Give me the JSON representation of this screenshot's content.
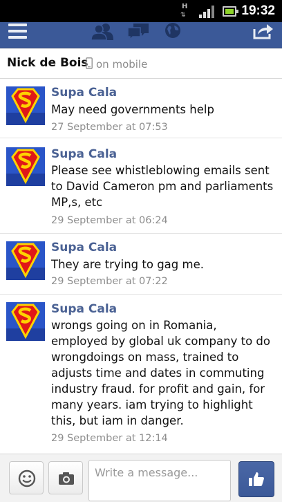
{
  "status_bar": {
    "network_label": "H",
    "time": "19:32",
    "signal_bars": 3,
    "signal_max": 4,
    "icons": [
      "network-h-icon",
      "signal-icon",
      "battery-icon"
    ]
  },
  "nav": {
    "icons": [
      "menu-icon",
      "friends-icon",
      "messages-icon",
      "globe-icon",
      "share-icon"
    ],
    "color": "#3b5998"
  },
  "conversation": {
    "name": "Nick de Bois",
    "status": "on mobile"
  },
  "messages": [
    {
      "sender": "Supa Cala",
      "text": "May need governments help",
      "time": "27 September at 07:53"
    },
    {
      "sender": "Supa Cala",
      "text": "Please see whistleblowing emails sent to David Cameron pm and parliaments MP,s, etc",
      "time": "29 September at 06:24"
    },
    {
      "sender": "Supa Cala",
      "text": "They are trying to gag me.",
      "time": "29 September at 07:22"
    },
    {
      "sender": "Supa Cala",
      "text": "wrongs going on in Romania, employed by global uk company to do wrongdoings on mass, trained to adjusts time and dates in commuting industry fraud. for profit and gain, for many years. iam trying to highlight this, but iam in danger.",
      "time": "29 September at 12:14"
    }
  ],
  "composer": {
    "placeholder": "Write a message...",
    "value": "",
    "icons": [
      "emoji-icon",
      "camera-icon",
      "thumbs-up-icon"
    ]
  },
  "colors": {
    "brand_blue": "#3b5998",
    "name_blue": "#4b6294",
    "timestamp_gray": "#8e8e8e"
  }
}
